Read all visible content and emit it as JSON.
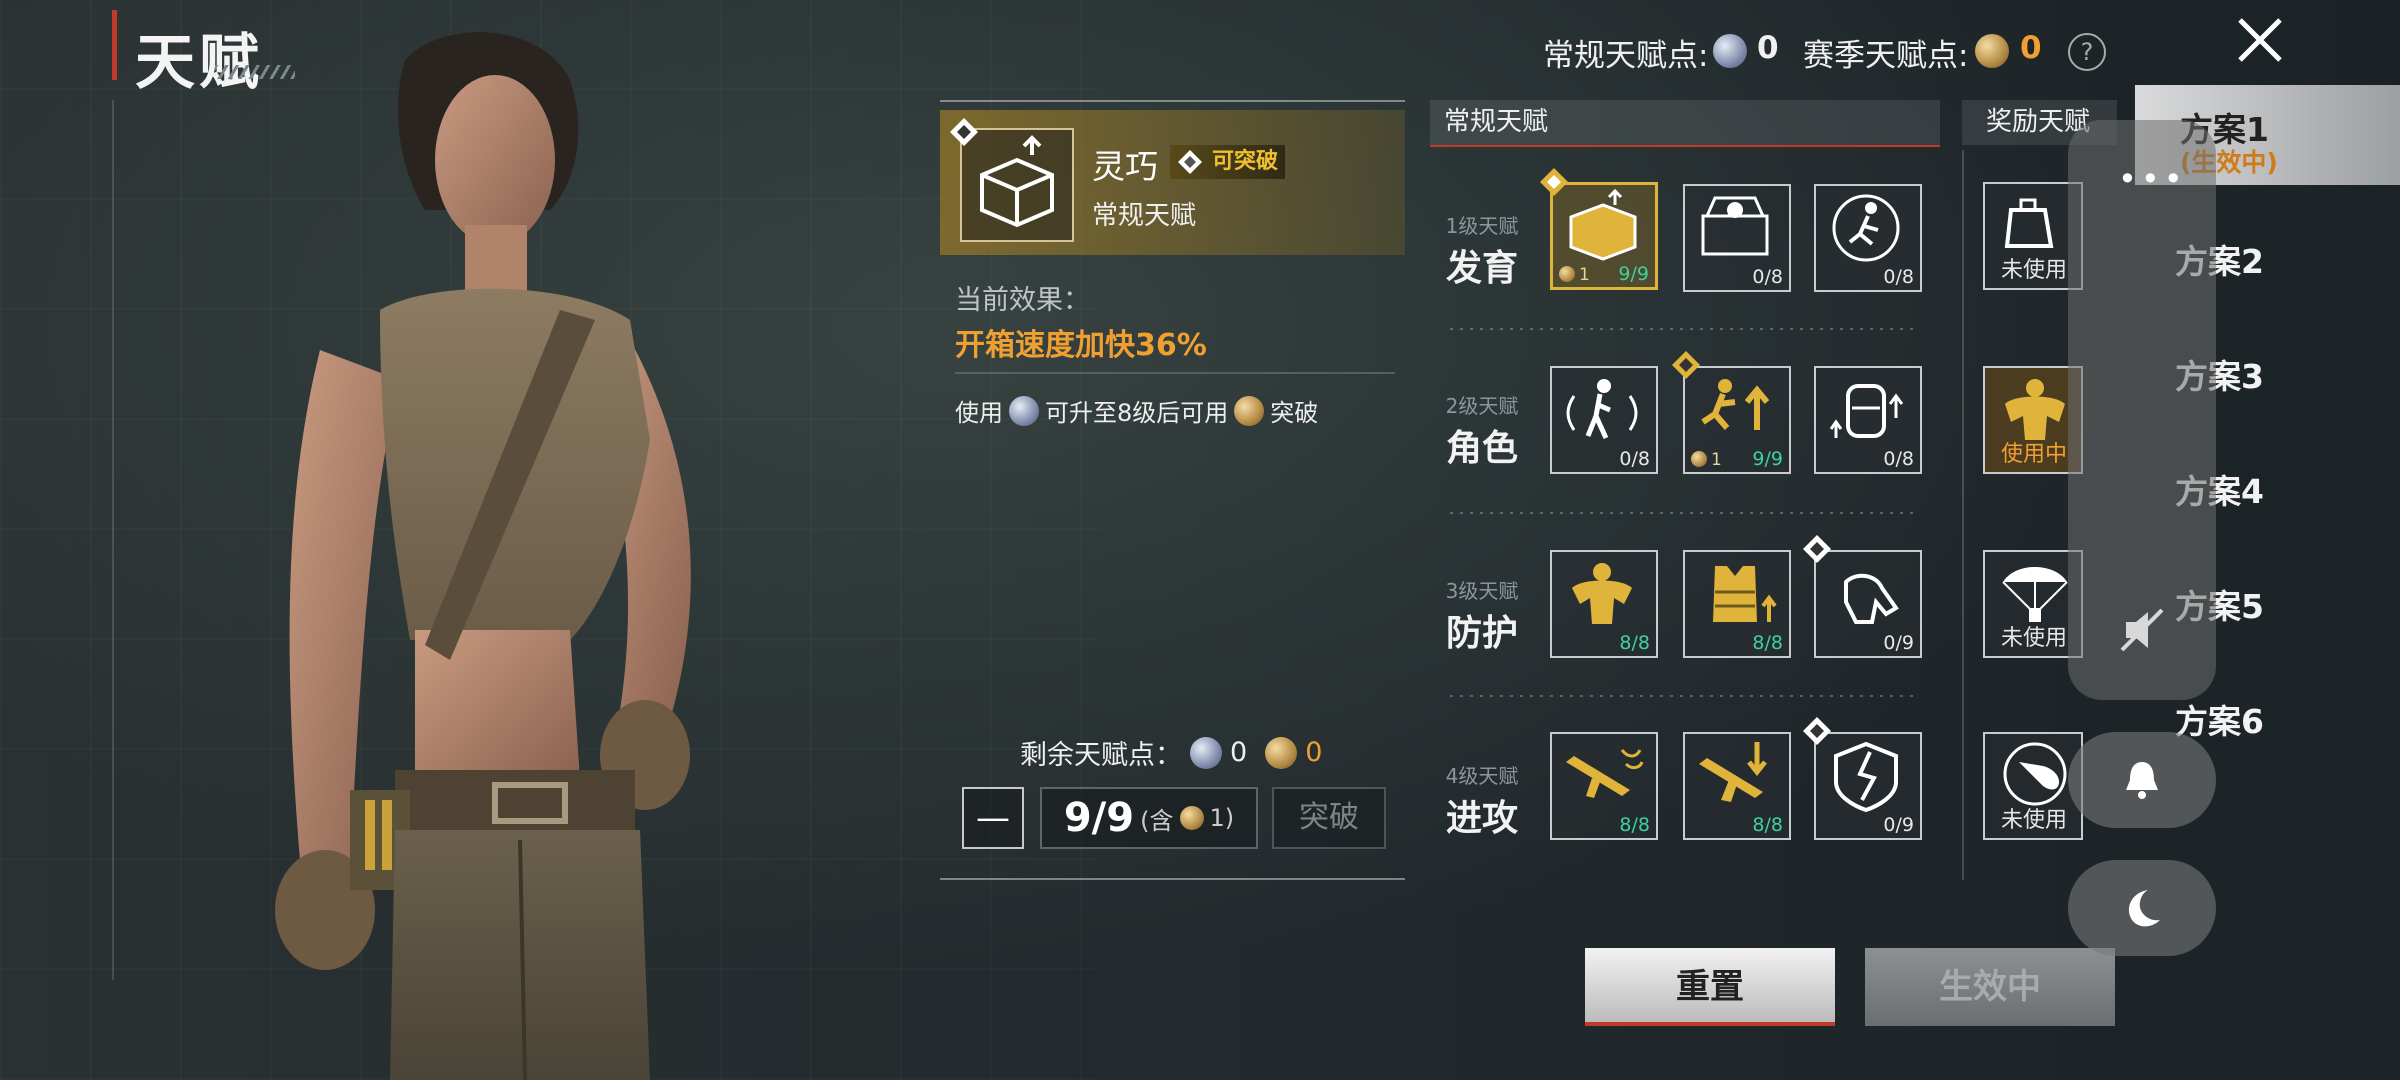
{
  "header": {
    "title": "天赋",
    "regular_points_label": "常规天赋点:",
    "regular_points_value": "0",
    "season_points_label": "赛季天赋点:",
    "season_points_value": "0",
    "help_symbol": "?"
  },
  "detail": {
    "name": "灵巧",
    "break_tag": "可突破",
    "type": "常规天赋",
    "effect_label": "当前效果：",
    "effect_value": "开箱速度加快36%",
    "usage_prefix": "使用",
    "usage_mid": "可升至8级后可用",
    "usage_suffix": "突破",
    "remaining_label": "剩余天赋点：",
    "remaining_regular": "0",
    "remaining_season": "0",
    "minus_symbol": "—",
    "level_value": "9/9",
    "level_sub_prefix": "(含",
    "level_sub_value": "1)",
    "break_button": "突破"
  },
  "grid": {
    "regular_header": "常规天赋",
    "reward_header": "奖励天赋",
    "tiers": [
      {
        "small": "1级天赋",
        "big": "发育",
        "slots": [
          {
            "icon": "supply-box-icon",
            "count": "9/9",
            "coin": "1",
            "selected": true,
            "breakable": true
          },
          {
            "icon": "medkit-case-icon",
            "count": "0/8"
          },
          {
            "icon": "runner-icon",
            "count": "0/8"
          }
        ],
        "reward": {
          "icon": "loot-bag-icon",
          "status": "未使用"
        }
      },
      {
        "small": "2级天赋",
        "big": "角色",
        "slots": [
          {
            "icon": "footstep-sound-icon",
            "count": "0/8"
          },
          {
            "icon": "sprint-up-icon",
            "count": "9/9",
            "coin": "1",
            "breakable": true
          },
          {
            "icon": "backpack-up-icon",
            "count": "0/8"
          }
        ],
        "reward": {
          "icon": "muscle-icon",
          "status": "使用中"
        }
      },
      {
        "small": "3级天赋",
        "big": "防护",
        "slots": [
          {
            "icon": "armor-body-icon",
            "count": "8/8"
          },
          {
            "icon": "vest-up-icon",
            "count": "8/8"
          },
          {
            "icon": "glove-icon",
            "count": "0/9",
            "breakable": true
          }
        ],
        "reward": {
          "icon": "parachute-icon",
          "status": "未使用"
        }
      },
      {
        "small": "4级天赋",
        "big": "进攻",
        "slots": [
          {
            "icon": "rifle-fire-icon",
            "count": "8/8"
          },
          {
            "icon": "rifle-reload-icon",
            "count": "8/8"
          },
          {
            "icon": "shield-break-icon",
            "count": "0/9",
            "breakable": true
          }
        ],
        "reward": {
          "icon": "bullet-icon",
          "status": "未使用"
        }
      }
    ]
  },
  "schemes": [
    {
      "label": "方案1",
      "sub": "(生效中)",
      "active": true
    },
    {
      "label": "方案2"
    },
    {
      "label": "方案3"
    },
    {
      "label": "方案4"
    },
    {
      "label": "方案5"
    },
    {
      "label": "方案6"
    }
  ],
  "buttons": {
    "reset": "重置",
    "active": "生效中"
  },
  "overlay": {
    "more": "•••"
  },
  "colors": {
    "accent_gold": "#e0b43a",
    "accent_orange": "#f0a030",
    "accent_red": "#c0392b",
    "count_green": "#3fd0a0"
  }
}
